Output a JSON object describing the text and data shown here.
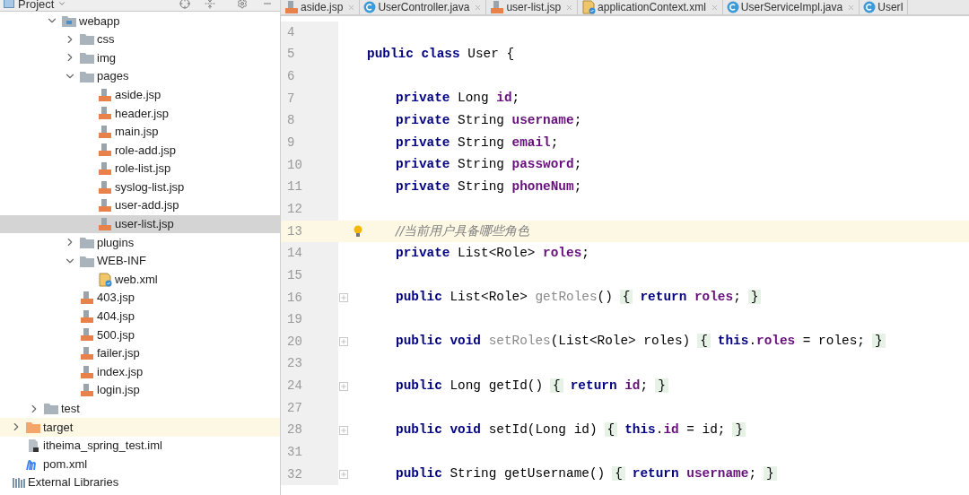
{
  "project_panel": {
    "title": "Project",
    "tree": [
      {
        "children": [
          {
            "children": [
              {
                "label": "webapp",
                "kind": "web-folder",
                "expanded": true,
                "selected": false,
                "children": [
                  {
                    "label": "css",
                    "kind": "folder",
                    "expanded": false,
                    "selected": false
                  },
                  {
                    "label": "img",
                    "kind": "folder",
                    "expanded": false,
                    "selected": false
                  },
                  {
                    "label": "pages",
                    "kind": "folder",
                    "expanded": true,
                    "selected": false,
                    "children": [
                      {
                        "label": "aside.jsp",
                        "kind": "jsp",
                        "selected": false
                      },
                      {
                        "label": "header.jsp",
                        "kind": "jsp",
                        "selected": false
                      },
                      {
                        "label": "main.jsp",
                        "kind": "jsp",
                        "selected": false
                      },
                      {
                        "label": "role-add.jsp",
                        "kind": "jsp",
                        "selected": false
                      },
                      {
                        "label": "role-list.jsp",
                        "kind": "jsp",
                        "selected": false
                      },
                      {
                        "label": "syslog-list.jsp",
                        "kind": "jsp",
                        "selected": false
                      },
                      {
                        "label": "user-add.jsp",
                        "kind": "jsp",
                        "selected": false
                      },
                      {
                        "label": "user-list.jsp",
                        "kind": "jsp",
                        "selected": true
                      }
                    ]
                  },
                  {
                    "label": "plugins",
                    "kind": "folder",
                    "expanded": false,
                    "selected": false
                  },
                  {
                    "label": "WEB-INF",
                    "kind": "folder",
                    "expanded": true,
                    "selected": false,
                    "children": [
                      {
                        "label": "web.xml",
                        "kind": "xml",
                        "selected": false
                      }
                    ]
                  },
                  {
                    "label": "403.jsp",
                    "kind": "jsp",
                    "selected": false
                  },
                  {
                    "label": "404.jsp",
                    "kind": "jsp",
                    "selected": false
                  },
                  {
                    "label": "500.jsp",
                    "kind": "jsp",
                    "selected": false
                  },
                  {
                    "label": "failer.jsp",
                    "kind": "jsp",
                    "selected": false
                  },
                  {
                    "label": "index.jsp",
                    "kind": "jsp",
                    "selected": false
                  },
                  {
                    "label": "login.jsp",
                    "kind": "jsp",
                    "selected": false
                  }
                ]
              }
            ]
          },
          {
            "label": "test",
            "kind": "folder",
            "expanded": false,
            "selected": false
          }
        ]
      },
      {
        "label": "target",
        "kind": "excluded-folder",
        "expanded": false,
        "selected": false
      },
      {
        "label": "itheima_spring_test.iml",
        "kind": "iml",
        "selected": false
      },
      {
        "label": "pom.xml",
        "kind": "maven",
        "selected": false
      }
    ],
    "external_libraries": "External Libraries"
  },
  "tabs": [
    {
      "label": "aside.jsp",
      "kind": "jsp",
      "closable": true
    },
    {
      "label": "UserController.java",
      "kind": "class",
      "closable": true
    },
    {
      "label": "user-list.jsp",
      "kind": "jsp",
      "closable": true
    },
    {
      "label": "applicationContext.xml",
      "kind": "xml",
      "closable": true
    },
    {
      "label": "UserServiceImpl.java",
      "kind": "class",
      "closable": true
    },
    {
      "label": "UserI",
      "kind": "class",
      "closable": false
    }
  ],
  "editor": {
    "lines": [
      {
        "number": "4",
        "kind": "blank",
        "highlighted": false,
        "foldable": false,
        "bulb": false
      },
      {
        "number": "5",
        "kind": "class",
        "highlighted": false,
        "foldable": false,
        "bulb": false,
        "tokens": [
          {
            "kind": "kw",
            "text": "public class"
          },
          {
            "kind": "plain",
            "text": " User {"
          }
        ]
      },
      {
        "number": "6",
        "kind": "blank",
        "highlighted": false,
        "foldable": false,
        "bulb": false
      },
      {
        "number": "7",
        "kind": "member",
        "highlighted": false,
        "foldable": false,
        "bulb": false,
        "tokens": [
          {
            "kind": "kw",
            "text": "private"
          },
          {
            "kind": "plain",
            "text": " Long "
          },
          {
            "kind": "field",
            "text": "id"
          },
          {
            "kind": "plain",
            "text": ";"
          }
        ]
      },
      {
        "number": "8",
        "kind": "member",
        "highlighted": false,
        "foldable": false,
        "bulb": false,
        "tokens": [
          {
            "kind": "kw",
            "text": "private"
          },
          {
            "kind": "plain",
            "text": " String "
          },
          {
            "kind": "field",
            "text": "username"
          },
          {
            "kind": "plain",
            "text": ";"
          }
        ]
      },
      {
        "number": "9",
        "kind": "member",
        "highlighted": false,
        "foldable": false,
        "bulb": false,
        "tokens": [
          {
            "kind": "kw",
            "text": "private"
          },
          {
            "kind": "plain",
            "text": " String "
          },
          {
            "kind": "field",
            "text": "email"
          },
          {
            "kind": "plain",
            "text": ";"
          }
        ]
      },
      {
        "number": "10",
        "kind": "member",
        "highlighted": false,
        "foldable": false,
        "bulb": false,
        "tokens": [
          {
            "kind": "kw",
            "text": "private"
          },
          {
            "kind": "plain",
            "text": " String "
          },
          {
            "kind": "field",
            "text": "password"
          },
          {
            "kind": "plain",
            "text": ";"
          }
        ]
      },
      {
        "number": "11",
        "kind": "member",
        "highlighted": false,
        "foldable": false,
        "bulb": false,
        "tokens": [
          {
            "kind": "kw",
            "text": "private"
          },
          {
            "kind": "plain",
            "text": " String "
          },
          {
            "kind": "field",
            "text": "phoneNum"
          },
          {
            "kind": "plain",
            "text": ";"
          }
        ]
      },
      {
        "number": "12",
        "kind": "blank",
        "highlighted": false,
        "foldable": false,
        "bulb": false
      },
      {
        "number": "13",
        "kind": "member",
        "highlighted": true,
        "foldable": false,
        "bulb": true,
        "tokens": [
          {
            "kind": "comment",
            "text": "//当前用户具备哪些角色"
          }
        ]
      },
      {
        "number": "14",
        "kind": "member",
        "highlighted": false,
        "foldable": false,
        "bulb": false,
        "tokens": [
          {
            "kind": "kw",
            "text": "private"
          },
          {
            "kind": "plain",
            "text": " List<Role> "
          },
          {
            "kind": "field",
            "text": "roles"
          },
          {
            "kind": "plain",
            "text": ";"
          }
        ]
      },
      {
        "number": "15",
        "kind": "blank",
        "highlighted": false,
        "foldable": false,
        "bulb": false
      },
      {
        "number": "16",
        "kind": "member",
        "highlighted": false,
        "foldable": true,
        "bulb": false,
        "tokens": [
          {
            "kind": "kw",
            "text": "public"
          },
          {
            "kind": "plain",
            "text": " List<Role> "
          },
          {
            "kind": "unused",
            "text": "getRoles"
          },
          {
            "kind": "plain",
            "text": "()"
          },
          {
            "kind": "open-fold",
            "text": "{"
          },
          {
            "kind": "kw",
            "text": "return"
          },
          {
            "kind": "field",
            "text": " roles"
          },
          {
            "kind": "plain",
            "text": ";"
          },
          {
            "kind": "close-fold",
            "text": "}"
          }
        ]
      },
      {
        "number": "19",
        "kind": "blank",
        "highlighted": false,
        "foldable": false,
        "bulb": false
      },
      {
        "number": "20",
        "kind": "member",
        "highlighted": false,
        "foldable": true,
        "bulb": false,
        "tokens": [
          {
            "kind": "kw",
            "text": "public void"
          },
          {
            "kind": "unused",
            "text": " setRoles"
          },
          {
            "kind": "plain",
            "text": "(List<Role> roles)"
          },
          {
            "kind": "open-fold",
            "text": "{"
          },
          {
            "kind": "kw",
            "text": "this"
          },
          {
            "kind": "plain",
            "text": "."
          },
          {
            "kind": "field",
            "text": "roles"
          },
          {
            "kind": "plain",
            "text": " = roles;"
          },
          {
            "kind": "close-fold",
            "text": "}"
          }
        ]
      },
      {
        "number": "23",
        "kind": "blank",
        "highlighted": false,
        "foldable": false,
        "bulb": false
      },
      {
        "number": "24",
        "kind": "member",
        "highlighted": false,
        "foldable": true,
        "bulb": false,
        "tokens": [
          {
            "kind": "kw",
            "text": "public"
          },
          {
            "kind": "plain",
            "text": " Long getId()"
          },
          {
            "kind": "open-fold",
            "text": "{"
          },
          {
            "kind": "kw",
            "text": "return"
          },
          {
            "kind": "field",
            "text": " id"
          },
          {
            "kind": "plain",
            "text": ";"
          },
          {
            "kind": "close-fold",
            "text": "}"
          }
        ]
      },
      {
        "number": "27",
        "kind": "blank",
        "highlighted": false,
        "foldable": false,
        "bulb": false
      },
      {
        "number": "28",
        "kind": "member",
        "highlighted": false,
        "foldable": true,
        "bulb": false,
        "tokens": [
          {
            "kind": "kw",
            "text": "public void"
          },
          {
            "kind": "plain",
            "text": " setId(Long id)"
          },
          {
            "kind": "open-fold",
            "text": "{"
          },
          {
            "kind": "kw",
            "text": "this"
          },
          {
            "kind": "plain",
            "text": "."
          },
          {
            "kind": "field",
            "text": "id"
          },
          {
            "kind": "plain",
            "text": " = id;"
          },
          {
            "kind": "close-fold",
            "text": "}"
          }
        ]
      },
      {
        "number": "31",
        "kind": "blank",
        "highlighted": false,
        "foldable": false,
        "bulb": false
      },
      {
        "number": "32",
        "kind": "member",
        "highlighted": false,
        "foldable": true,
        "bulb": false,
        "tokens": [
          {
            "kind": "kw",
            "text": "public"
          },
          {
            "kind": "plain",
            "text": " String getUsername()"
          },
          {
            "kind": "open-fold",
            "text": "{"
          },
          {
            "kind": "kw",
            "text": "return"
          },
          {
            "kind": "field",
            "text": " username"
          },
          {
            "kind": "plain",
            "text": ";"
          },
          {
            "kind": "close-fold",
            "text": "}"
          }
        ]
      }
    ]
  }
}
